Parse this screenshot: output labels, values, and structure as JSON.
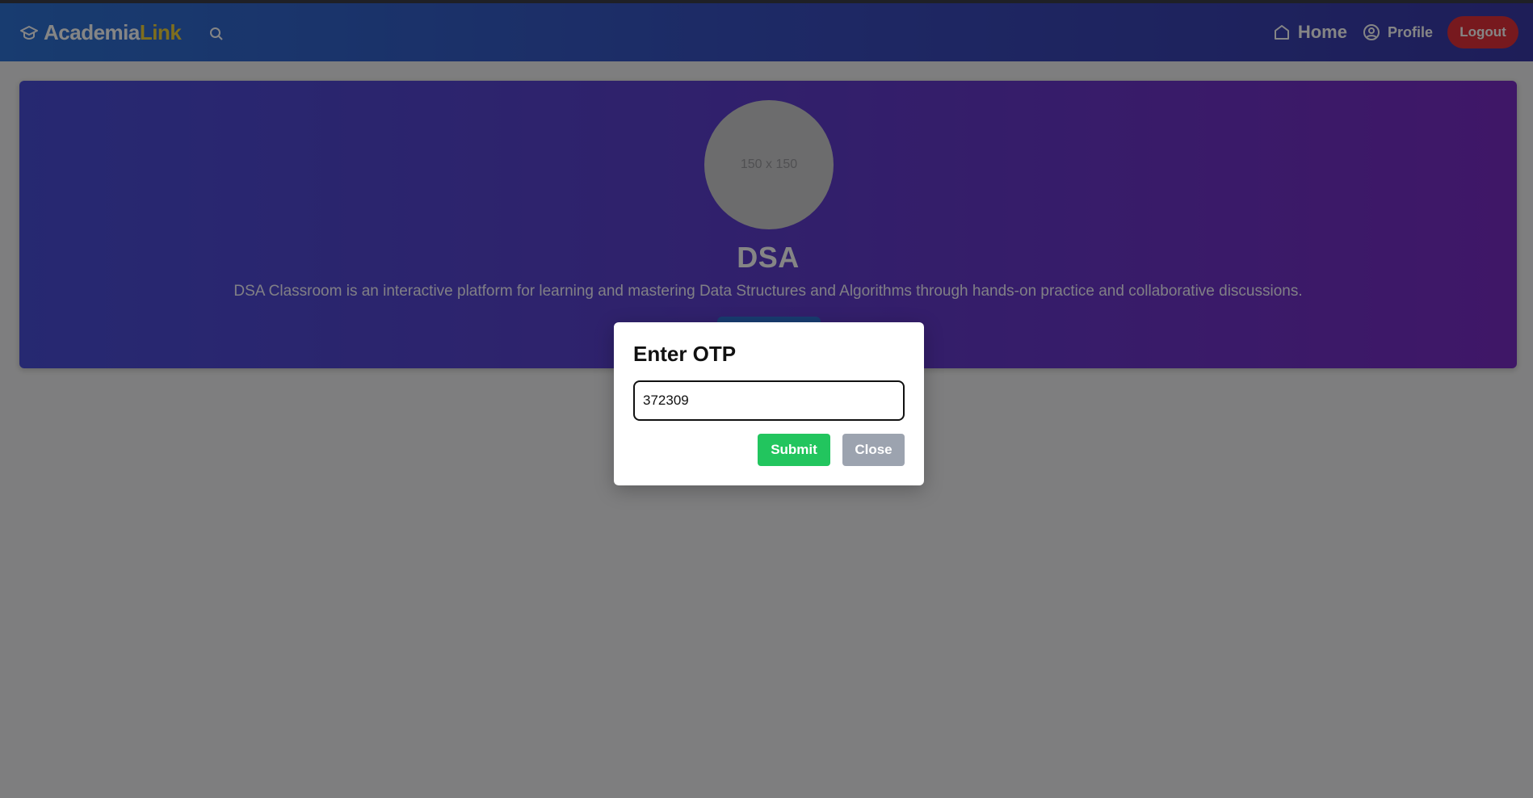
{
  "navbar": {
    "brand_part1": "Academia",
    "brand_part2": "Link",
    "home_label": "Home",
    "profile_label": "Profile",
    "logout_label": "Logout",
    "icons": [
      "graduation-cap-icon",
      "search-icon",
      "home-icon",
      "user-circle-icon"
    ]
  },
  "hero": {
    "avatar_placeholder": "150 x 150",
    "title": "DSA",
    "description": "DSA Classroom is an interactive platform for learning and mastering Data Structures and Algorithms through hands-on practice and collaborative discussions."
  },
  "modal": {
    "title": "Enter OTP",
    "otp_value": "372309",
    "submit_label": "Submit",
    "close_label": "Close"
  },
  "colors": {
    "brand_accent": "#f2d33a",
    "logout": "#e5313b",
    "submit": "#22c55e",
    "close": "#9ca3af"
  }
}
